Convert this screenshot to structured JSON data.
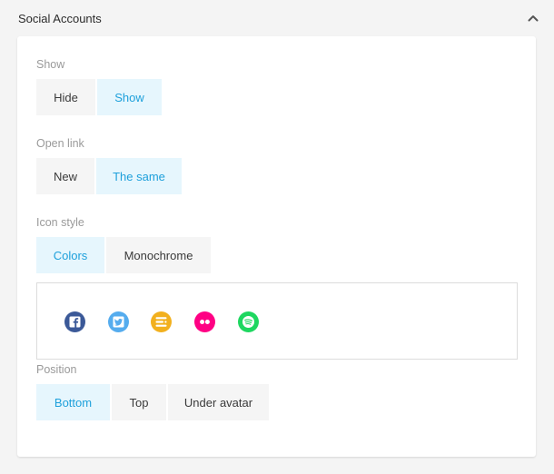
{
  "panel": {
    "title": "Social Accounts"
  },
  "show": {
    "label": "Show",
    "options": [
      "Hide",
      "Show"
    ],
    "selected": "Show"
  },
  "open_link": {
    "label": "Open link",
    "options": [
      "New",
      "The same"
    ],
    "selected": "The same"
  },
  "icon_style": {
    "label": "Icon style",
    "options": [
      "Colors",
      "Monochrome"
    ],
    "selected": "Colors"
  },
  "social_icons": [
    {
      "name": "facebook-icon",
      "color": "#3b5998"
    },
    {
      "name": "twitter-icon",
      "color": "#55acee"
    },
    {
      "name": "blogger-icon",
      "color": "#f2b01e"
    },
    {
      "name": "flickr-icon",
      "color": "#ff0084"
    },
    {
      "name": "spotify-icon",
      "color": "#1ed760"
    }
  ],
  "position": {
    "label": "Position",
    "options": [
      "Bottom",
      "Top",
      "Under avatar"
    ],
    "selected": "Bottom"
  },
  "colors": {
    "accent": "#1ea0db",
    "active_bg": "#e6f6fd"
  }
}
